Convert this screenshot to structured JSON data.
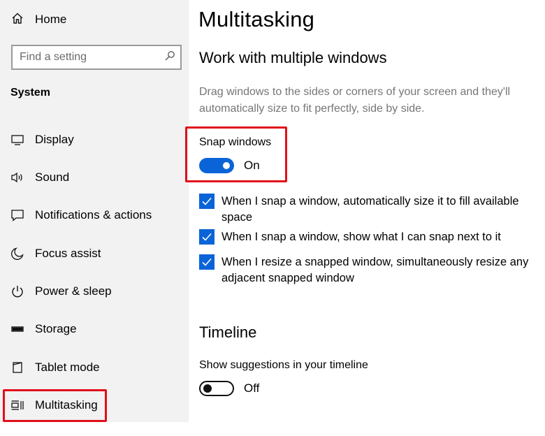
{
  "sidebar": {
    "home_label": "Home",
    "search_placeholder": "Find a setting",
    "section_title": "System",
    "items": [
      {
        "label": "Display",
        "icon": "monitor-icon"
      },
      {
        "label": "Sound",
        "icon": "speaker-icon"
      },
      {
        "label": "Notifications & actions",
        "icon": "notification-icon"
      },
      {
        "label": "Focus assist",
        "icon": "moon-icon"
      },
      {
        "label": "Power & sleep",
        "icon": "power-icon"
      },
      {
        "label": "Storage",
        "icon": "storage-icon"
      },
      {
        "label": "Tablet mode",
        "icon": "tablet-icon"
      },
      {
        "label": "Multitasking",
        "icon": "multitasking-icon"
      }
    ],
    "selected": "Multitasking"
  },
  "main": {
    "title": "Multitasking",
    "windows_section": {
      "heading": "Work with multiple windows",
      "description": "Drag windows to the sides or corners of your screen and they'll automatically size to fit perfectly, side by side.",
      "snap_label": "Snap windows",
      "snap_state": "On",
      "options": [
        {
          "text": "When I snap a window, automatically size it to fill available space",
          "checked": true
        },
        {
          "text": "When I snap a window, show what I can snap next to it",
          "checked": true
        },
        {
          "text": "When I resize a snapped window, simultaneously resize any adjacent snapped window",
          "checked": true
        }
      ]
    },
    "timeline_section": {
      "heading": "Timeline",
      "suggestions_label": "Show suggestions in your timeline",
      "suggestions_state": "Off"
    }
  },
  "colors": {
    "accent": "#0a64d8",
    "highlight": "#e0101b",
    "sidebar_bg": "#f2f2f2",
    "description_text": "#767676"
  }
}
